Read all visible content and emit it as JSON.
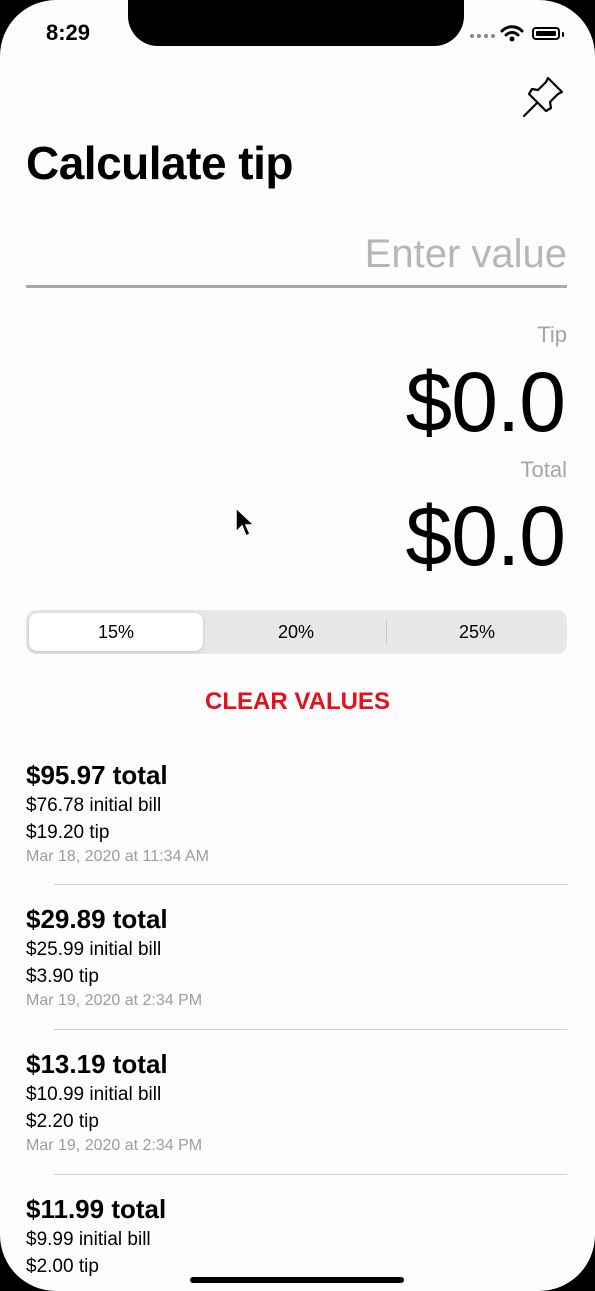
{
  "status_bar": {
    "time": "8:29"
  },
  "title": "Calculate tip",
  "input": {
    "placeholder": "Enter value"
  },
  "tip": {
    "label": "Tip",
    "value": "$0.0"
  },
  "total": {
    "label": "Total",
    "value": "$0.0"
  },
  "segments": {
    "options": [
      "15%",
      "20%",
      "25%"
    ],
    "selected": "15%"
  },
  "clear_label": "CLEAR VALUES",
  "history": [
    {
      "total": "$95.97 total",
      "bill": "$76.78 initial bill",
      "tip": "$19.20 tip",
      "date": "Mar 18, 2020 at 11:34 AM"
    },
    {
      "total": "$29.89 total",
      "bill": "$25.99 initial bill",
      "tip": "$3.90 tip",
      "date": "Mar 19, 2020 at 2:34 PM"
    },
    {
      "total": "$13.19 total",
      "bill": "$10.99 initial bill",
      "tip": "$2.20 tip",
      "date": "Mar 19, 2020 at 2:34 PM"
    },
    {
      "total": "$11.99 total",
      "bill": "$9.99 initial bill",
      "tip": "$2.00 tip"
    }
  ],
  "icons": {
    "pin": "pushpin-icon",
    "pointer": "mouse-pointer-icon"
  },
  "colors": {
    "accent": "#e1121d",
    "background": "#fefcfd",
    "segment_bg": "#e8e7e8"
  }
}
